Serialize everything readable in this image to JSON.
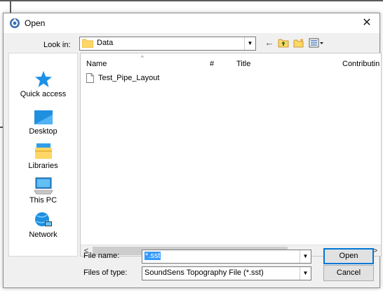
{
  "dialog": {
    "title": "Open",
    "close_glyph": "✕"
  },
  "look_in": {
    "label": "Look in:",
    "value": "Data",
    "arrow": "▼"
  },
  "toolbar": {
    "back": "←",
    "up_folder": "⬆",
    "new_folder": "✱",
    "view_menu": "▦▾"
  },
  "places": [
    {
      "label": "Quick access",
      "icon": "star-icon"
    },
    {
      "label": "Desktop",
      "icon": "desktop-icon"
    },
    {
      "label": "Libraries",
      "icon": "libraries-icon"
    },
    {
      "label": "This PC",
      "icon": "computer-icon"
    },
    {
      "label": "Network",
      "icon": "network-icon"
    }
  ],
  "list": {
    "columns": [
      "Name",
      "#",
      "Title",
      "Contributin"
    ],
    "sort_caret": "^",
    "files": [
      {
        "name": "Test_Pipe_Layout",
        "icon": "document-icon"
      }
    ]
  },
  "scroll": {
    "left": "<",
    "right": ">"
  },
  "file_name": {
    "label": "File name:",
    "value": "*.sst",
    "arrow": "▼"
  },
  "file_type": {
    "label": "Files of type:",
    "value": "SoundSens Topography File (*.sst)",
    "arrow": "▼"
  },
  "buttons": {
    "open": "Open",
    "cancel": "Cancel"
  },
  "colors": {
    "accent": "#0078d7",
    "selection": "#3399ff",
    "folder": "#ffd766"
  }
}
